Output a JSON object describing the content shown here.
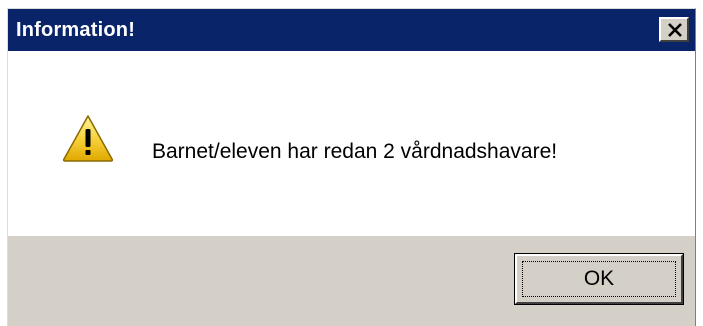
{
  "window": {
    "title": "Information!",
    "close_icon": "close-x-icon",
    "title_bar_color": "#0a246a",
    "body_color": "#d4d0c8"
  },
  "message": {
    "icon": "warning-triangle-icon",
    "text": "Barnet/eleven har redan 2 vårdnadshavare!"
  },
  "buttons": {
    "ok_label": "OK"
  }
}
